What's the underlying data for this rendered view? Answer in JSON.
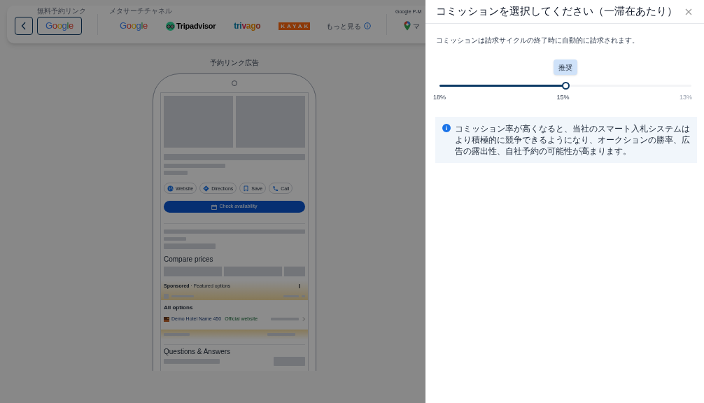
{
  "top_bar": {
    "free_booking": {
      "label": "無料予約リンク",
      "buttons": [
        {
          "kind": "google",
          "name": "Google",
          "selected": true
        }
      ]
    },
    "metasearch": {
      "label": "メタサーチチャネル",
      "channels": [
        {
          "kind": "google",
          "name": "Google",
          "selected": false
        },
        {
          "kind": "tripadvisor",
          "name": "Tripadvisor",
          "selected": false
        },
        {
          "kind": "trivago",
          "name": "trivago",
          "selected": false
        },
        {
          "kind": "kayak",
          "name": "KAYAK",
          "selected": false
        }
      ],
      "more": "もっと見る"
    },
    "google_pm": {
      "label": "Google P-M",
      "item": "マ"
    }
  },
  "preview": {
    "title": "予約リンク広告",
    "actions": [
      {
        "kind": "website",
        "label": "Website"
      },
      {
        "kind": "directions",
        "label": "Directions"
      },
      {
        "kind": "save",
        "label": "Save"
      },
      {
        "kind": "call",
        "label": "Call"
      }
    ],
    "cta": "Check availability",
    "compare_title": "Compare prices",
    "sponsored": "**Sponsored** · Featured options",
    "all_options": "All options",
    "hotel_name": "Demo Hotel Name 450",
    "hotel_link": "Official website",
    "qa_title": "Questions & Answers"
  },
  "drawer": {
    "title": "コミッションを選択してください（一滞在あたり）",
    "description": "コミッションは請求サイクルの終了時に自動的に請求されます。",
    "slider": {
      "level": 0.5,
      "tooltip": "推奨",
      "labels": [
        "18%",
        "15%",
        "13%"
      ]
    },
    "info": "コミッション率が高くなると、当社のスマート入札システムはより積極的に競争できるようになり、オークションの勝率、広告の露出性、自社予約の可能性が高まります。"
  }
}
